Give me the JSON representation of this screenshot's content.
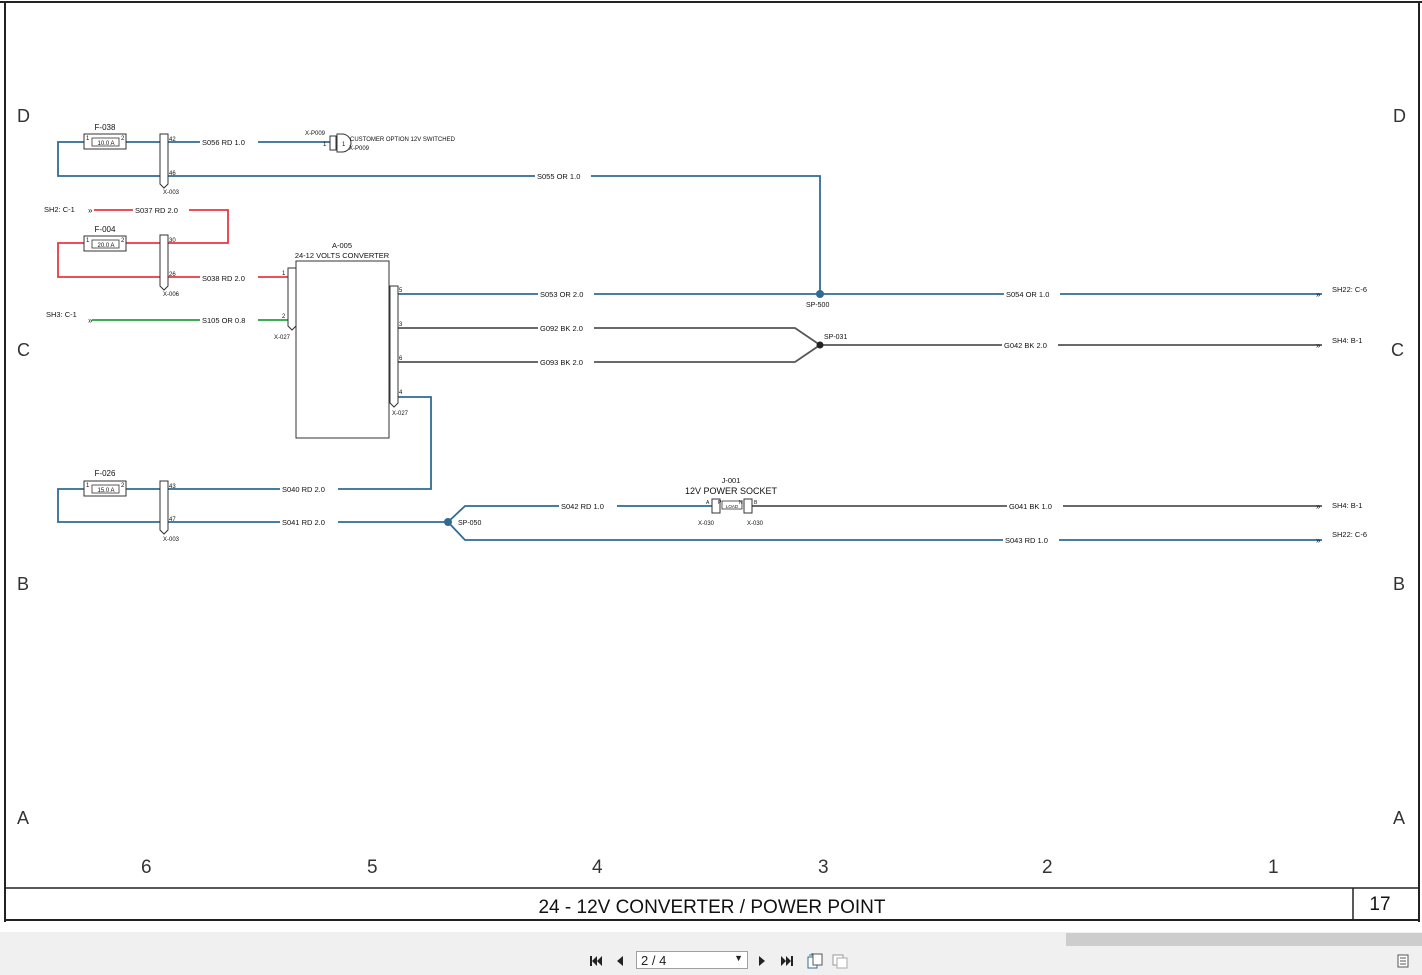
{
  "drawing": {
    "title": "24 - 12V CONVERTER / POWER POINT",
    "sheet_number": "17",
    "row_labels": [
      "D",
      "C",
      "B",
      "A"
    ],
    "column_labels": [
      "6",
      "5",
      "4",
      "3",
      "2",
      "1"
    ]
  },
  "fuses": [
    {
      "id": "F-038",
      "rating": "10.0 A",
      "pin_left": "1",
      "pin_right": "2"
    },
    {
      "id": "F-004",
      "rating": "20.0 A",
      "pin_left": "1",
      "pin_right": "2"
    },
    {
      "id": "F-026",
      "rating": "15.0 A",
      "pin_left": "1",
      "pin_right": "2"
    }
  ],
  "connectors": {
    "x003_top": {
      "label": "X-003",
      "pins": [
        "42",
        "46"
      ]
    },
    "x006": {
      "label": "X-006",
      "pins": [
        "30",
        "26"
      ]
    },
    "x003_bottom": {
      "label": "X-003",
      "pins": [
        "43",
        "47"
      ]
    },
    "x027_left": {
      "label": "X-027",
      "pins": [
        "1",
        "2"
      ]
    },
    "x027_right": {
      "label": "X-027",
      "pins": [
        "5",
        "3",
        "6",
        "4"
      ]
    },
    "xp009": {
      "label_top": "X-P009",
      "label_bottom": "X-P009",
      "pin": "1",
      "pin2": "1",
      "description": "CUSTOMER OPTION 12V SWITCHED"
    },
    "x030_left": {
      "label": "X-030",
      "pin": "A"
    },
    "x030_right": {
      "label": "X-030",
      "pin": "B"
    }
  },
  "converter": {
    "id": "A-005",
    "name": "24-12 VOLTS CONVERTER"
  },
  "socket": {
    "id": "J-001",
    "name": "12V POWER SOCKET",
    "pin_p": "P",
    "pin_n": "N",
    "inner": "LOAD"
  },
  "splices": [
    {
      "id": "SP-500"
    },
    {
      "id": "SP-031"
    },
    {
      "id": "SP-050"
    }
  ],
  "wires": {
    "s056": "S056  RD  1.0",
    "s055": "S055  OR  1.0",
    "s037": "S037  RD  2.0",
    "s038": "S038  RD  2.0",
    "s105": "S105  OR  0.8",
    "s053": "S053  OR  2.0",
    "s054": "S054  OR  1.0",
    "g092": "G092  BK  2.0",
    "g093": "G093  BK  2.0",
    "g042": "G042  BK  2.0",
    "s040": "S040  RD  2.0",
    "s041": "S041  RD  2.0",
    "s042": "S042  RD  1.0",
    "g041": "G041  BK  1.0",
    "s043": "S043  RD  1.0"
  },
  "references": {
    "sh2_c1": "SH2: C-1",
    "sh3_c1": "SH3: C-1",
    "sh22_c6_a": "SH22: C-6",
    "sh4_b1_a": "SH4: B-1",
    "sh4_b1_b": "SH4: B-1",
    "sh22_c6_b": "SH22: C-6"
  },
  "colors": {
    "wire_blue": "#2f6b94",
    "wire_red": "#e8393f",
    "wire_green": "#23a33e",
    "wire_dark": "#555555",
    "splice": "#2f6b94"
  },
  "viewer": {
    "page_indicator": "2 / 4",
    "icons": [
      "first-page-icon",
      "prev-page-icon",
      "next-page-icon",
      "last-page-icon",
      "rotate-icon",
      "fit-page-icon",
      "document-icon"
    ]
  }
}
